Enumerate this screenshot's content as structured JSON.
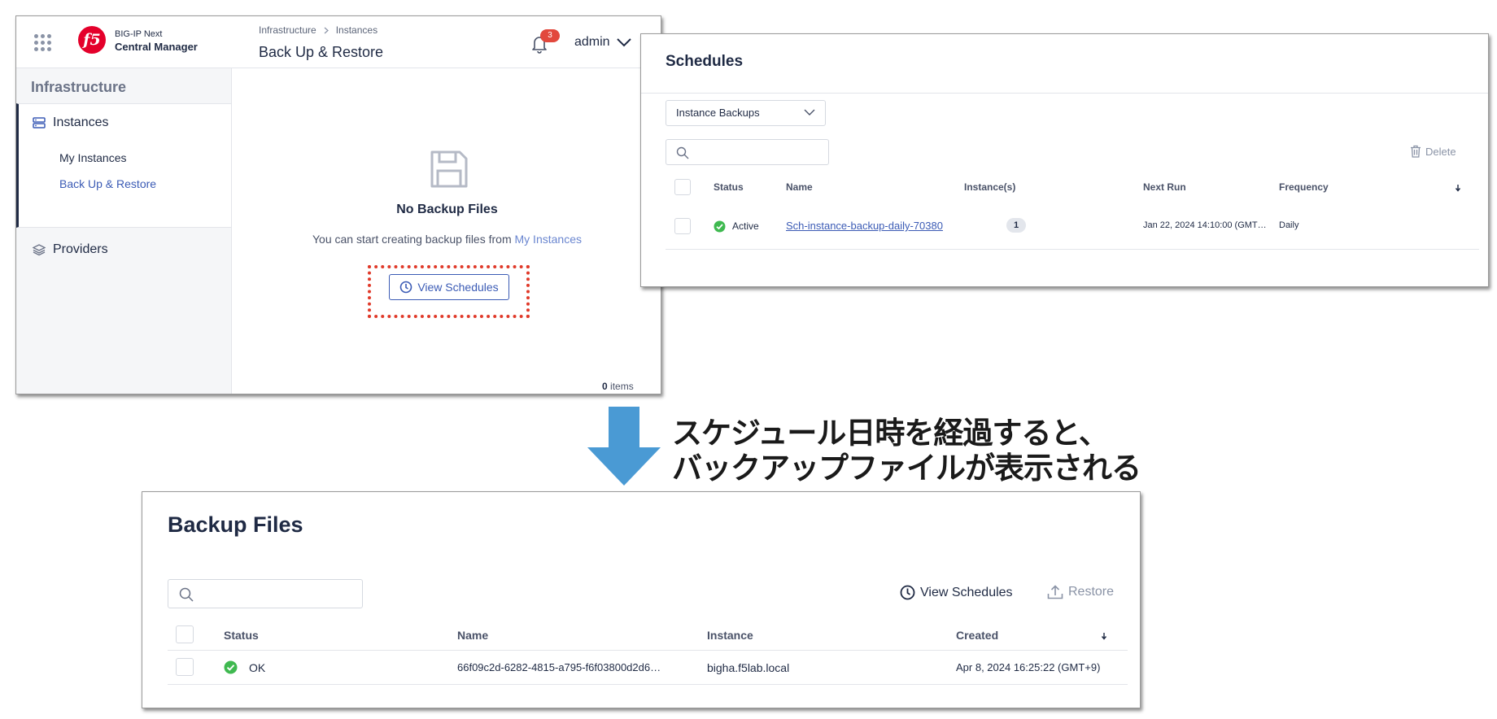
{
  "central_manager": {
    "brand": {
      "line1": "BIG-IP Next",
      "line2": "Central Manager",
      "logo_text": "f5"
    },
    "sidebar": {
      "section_title": "Infrastructure",
      "instances_label": "Instances",
      "sub_items": [
        "My Instances",
        "Back Up & Restore"
      ],
      "providers_label": "Providers"
    },
    "breadcrumb": [
      "Infrastructure",
      "Instances"
    ],
    "page_title": "Back Up & Restore",
    "notification_count": "3",
    "user": "admin",
    "empty_state": {
      "title": "No Backup Files",
      "description": "You can start creating backup files from ",
      "link": "My Instances",
      "button": "View Schedules"
    },
    "items_count": "0",
    "items_label": " items"
  },
  "schedules": {
    "title": "Schedules",
    "select_value": "Instance Backups",
    "delete_label": "Delete",
    "columns": [
      "Status",
      "Name",
      "Instance(s)",
      "Next Run",
      "Frequency"
    ],
    "rows": [
      {
        "status": "Active",
        "name": "Sch-instance-backup-daily-70380",
        "instances": "1",
        "next_run": "Jan 22, 2024 14:10:00 (GMT…",
        "frequency": "Daily"
      }
    ]
  },
  "caption": {
    "line1": "スケジュール日時を経過すると、",
    "line2": "バックアップファイルが表示される"
  },
  "backup_files": {
    "title": "Backup Files",
    "view_schedules_label": "View Schedules",
    "restore_label": "Restore",
    "columns": [
      "Status",
      "Name",
      "Instance",
      "Created"
    ],
    "rows": [
      {
        "status": "OK",
        "name": "66f09c2d-6282-4815-a795-f6f03800d2d6…",
        "instance": "bigha.f5lab.local",
        "created": "Apr 8, 2024 16:25:22 (GMT+9)"
      }
    ]
  },
  "colors": {
    "accent": "#3b5bb5",
    "highlight": "#e03a2a",
    "arrow": "#4a9ad4",
    "success": "#3fb950",
    "brand": "#e4002b"
  }
}
